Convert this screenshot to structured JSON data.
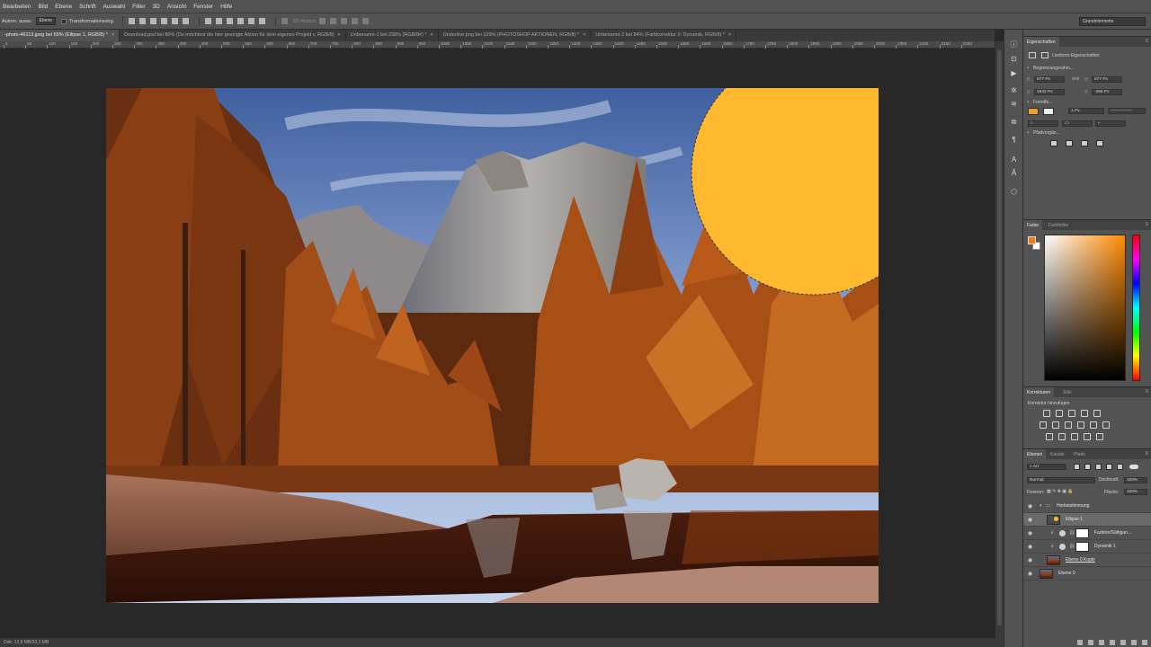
{
  "menu": [
    "Bearbeiten",
    "Bild",
    "Ebene",
    "Schrift",
    "Auswahl",
    "Filter",
    "3D",
    "Ansicht",
    "Fenster",
    "Hilfe"
  ],
  "options_bar": {
    "auto_select_label": "Autom. ausw.:",
    "auto_select_value": "Ebene",
    "transform_label": "Transformationsstrg.",
    "mode_3d_label": "3D-Modus:",
    "workspace": "Grundelemente"
  },
  "tabs": [
    {
      "label": "-photo-46113.jpeg bei 65% (Ellipse 1, RGB/8) *",
      "active": true
    },
    {
      "label": "Download.psd bei 80% (Du möchtest die hier gezeigte Aktion für dein eigenes Projekt v, RGB/8)",
      "active": false
    },
    {
      "label": "Unbenannt-1 bei 238% (RGB/8#) *",
      "active": false
    },
    {
      "label": "Underline.png bei 129% (PHOTOSHOP AKTIONEN, RGB/8) *",
      "active": false
    },
    {
      "label": "Unbenannt-2 bei 84% (Farbkorrektur 2: Dynamik, RGB/8) *",
      "active": false
    }
  ],
  "ruler_numbers": [
    "0",
    "50",
    "100",
    "150",
    "200",
    "250",
    "300",
    "350",
    "400",
    "450",
    "500",
    "550",
    "600",
    "650",
    "700",
    "750",
    "800",
    "850",
    "900",
    "950",
    "1000",
    "1050",
    "1100",
    "1150",
    "1200",
    "1250",
    "1300",
    "1350",
    "1400",
    "1450",
    "1500",
    "1550",
    "1600",
    "1650",
    "1700",
    "1750",
    "1800",
    "1850",
    "1900",
    "1950",
    "2000",
    "2050",
    "2100",
    "2150",
    "2200"
  ],
  "status": {
    "doc": "Dok: 12,9 MB/33,1 MB"
  },
  "properties": {
    "title": "Eigenschaften",
    "subtitle": "Liveform-Eigenschaften",
    "bounding_label": "Begrenzungsrahm...",
    "w_label": "B:",
    "w_value": "877 Px",
    "h_label": "H:",
    "h_value": "877 Px",
    "x_label": "X:",
    "x_value": "1942 Px",
    "y_label": "Y:",
    "y_value": "-266 Px",
    "stroke_size": "1 Px",
    "fill_label": "Formflä...",
    "path_label": "Pfadvorgän...",
    "fill_color": "#f2a01f"
  },
  "color_panel": {
    "tab1": "Farbe",
    "tab2": "Farbfelder",
    "fg": "#f07a13",
    "bg": "#ffffff"
  },
  "adjustments": {
    "tab1": "Korrekturen",
    "tab2": "Stile",
    "add_label": "Korrektur hinzufügen"
  },
  "layers": {
    "tabs": [
      "Ebenen",
      "Kanäle",
      "Pfade"
    ],
    "kind_filter": "Art",
    "blend_mode": "Normal",
    "opacity_label": "Deckkraft:",
    "opacity_value": "100%",
    "lock_label": "Fixieren:",
    "fill_label": "Fläche:",
    "fill_value": "100%",
    "items": [
      {
        "name": "Herbststimmung",
        "type": "group"
      },
      {
        "name": "Ellipse 1",
        "type": "shape"
      },
      {
        "name": "Farbton/Sättigun...",
        "type": "adjust"
      },
      {
        "name": "Dynamik 1",
        "type": "adjust"
      },
      {
        "name": "Ebene 0 Kopie",
        "type": "image"
      },
      {
        "name": "Ebene 0",
        "type": "image"
      }
    ]
  },
  "ellipse_color": "#ffb92f"
}
